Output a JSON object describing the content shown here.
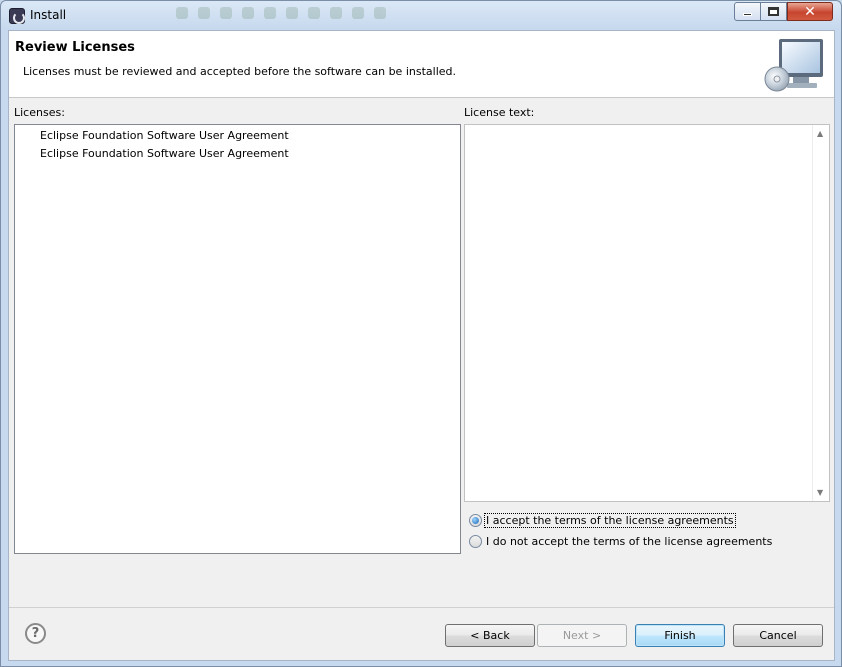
{
  "window": {
    "title": "Install",
    "close_glyph": "✕"
  },
  "header": {
    "title": "Review Licenses",
    "description": "Licenses must be reviewed and accepted before the software can be installed."
  },
  "licenses": {
    "label": "Licenses:",
    "items": [
      {
        "label": "Eclipse Foundation Software User Agreement"
      },
      {
        "label": "Eclipse Foundation Software User Agreement"
      }
    ]
  },
  "license_text": {
    "label": "License text:",
    "content": ""
  },
  "acceptance": {
    "accept_label": "I accept the terms of the license agreements",
    "decline_label": "I do not accept the terms of the license agreements",
    "selected": "accept"
  },
  "footer": {
    "help_glyph": "?",
    "back_label": "< Back",
    "next_label": "Next >",
    "finish_label": "Finish",
    "cancel_label": "Cancel"
  },
  "icons": {
    "app": "eclipse-icon",
    "wizard_banner": "monitor-cd-icon",
    "help": "help-icon"
  },
  "colors": {
    "accent": "#1a66b5",
    "default_button_border": "#3c7fb1",
    "close_button": "#c7452f"
  }
}
